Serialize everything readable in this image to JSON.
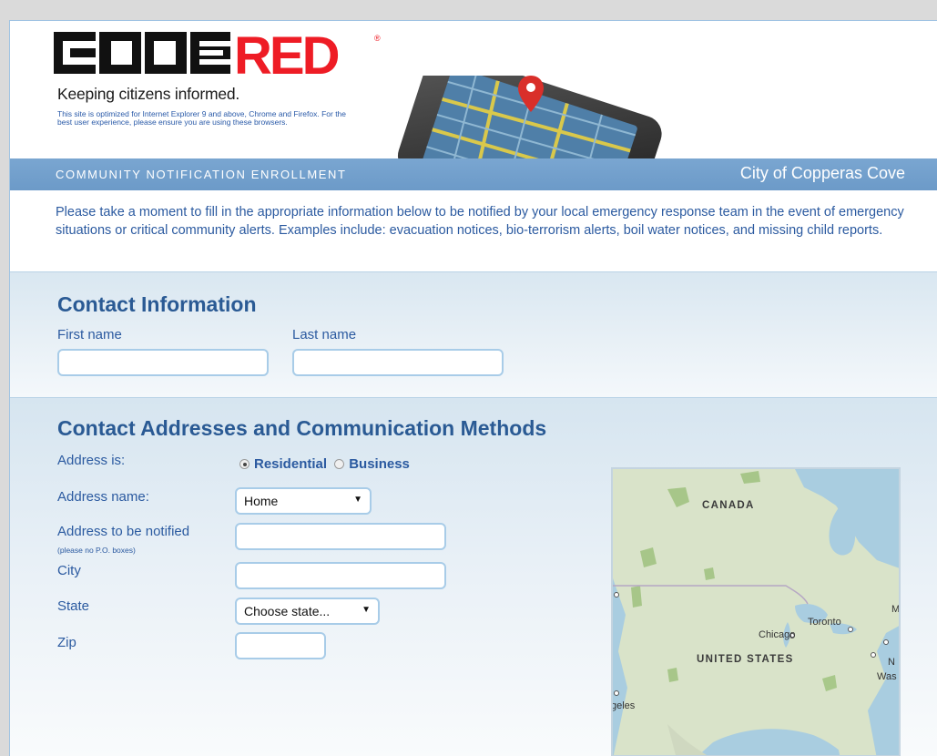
{
  "header": {
    "logo_text": "CODERED",
    "tagline": "Keeping citizens informed.",
    "browser_note": "This site is optimized for Internet Explorer 9 and above, Chrome and Firefox. For the best user experience, please ensure you are using these browsers."
  },
  "banner": {
    "title": "COMMUNITY NOTIFICATION ENROLLMENT",
    "city": "City of Copperas Cove"
  },
  "intro": "Please take a moment to fill in the appropriate information below to be notified by your local emergency response team in the event of emergency situations or critical community alerts. Examples include: evacuation notices, bio-terrorism alerts, boil water notices, and missing child reports.",
  "contact": {
    "title": "Contact Information",
    "first_name_label": "First name",
    "first_name_value": "",
    "last_name_label": "Last name",
    "last_name_value": ""
  },
  "address": {
    "title": "Contact Addresses and Communication Methods",
    "address_is_label": "Address is:",
    "type_options": [
      "Residential",
      "Business"
    ],
    "type_selected": "Residential",
    "address_name_label": "Address name:",
    "address_name_value": "Home",
    "address_label": "Address to be notified",
    "address_hint": "(please no P.O. boxes)",
    "address_value": "",
    "city_label": "City",
    "city_value": "",
    "state_label": "State",
    "state_value": "Choose state...",
    "zip_label": "Zip",
    "zip_value": ""
  },
  "map": {
    "labels": {
      "canada": "CANADA",
      "united_states": "UNITED STATES",
      "toronto": "Toronto",
      "chicago": "Chicago",
      "angeles_fragment": "geles",
      "washington_fragment": "Was",
      "n_fragment": "N",
      "m_fragment": "M"
    }
  },
  "colors": {
    "accent_red": "#ee1c25",
    "banner_blue": "#6e9cc9",
    "label_blue": "#2b5aa0",
    "title_blue": "#2a5a94",
    "field_border": "#a8cce8"
  }
}
